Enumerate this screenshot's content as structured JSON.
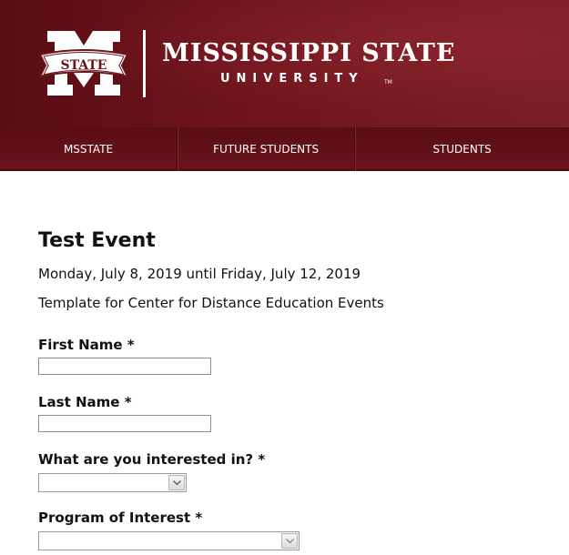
{
  "header": {
    "logo_text": "STATE",
    "university_name": "MISSISSIPPI STATE",
    "university_subtitle": "UNIVERSITY",
    "trademark": "TM"
  },
  "nav": {
    "items": [
      {
        "label": "MSSTATE"
      },
      {
        "label": "FUTURE STUDENTS"
      },
      {
        "label": "STUDENTS"
      }
    ]
  },
  "event": {
    "title": "Test Event",
    "dates": "Monday, July 8, 2019 until Friday, July 12, 2019",
    "description": "Template for Center for Distance Education Events"
  },
  "form": {
    "first_name": {
      "label": "First Name *",
      "value": ""
    },
    "last_name": {
      "label": "Last Name *",
      "value": ""
    },
    "interest": {
      "label": "What are you interested in? *",
      "selected": ""
    },
    "program": {
      "label": "Program of Interest *",
      "selected": ""
    }
  },
  "colors": {
    "maroon": "#5d1725",
    "white": "#ffffff"
  }
}
